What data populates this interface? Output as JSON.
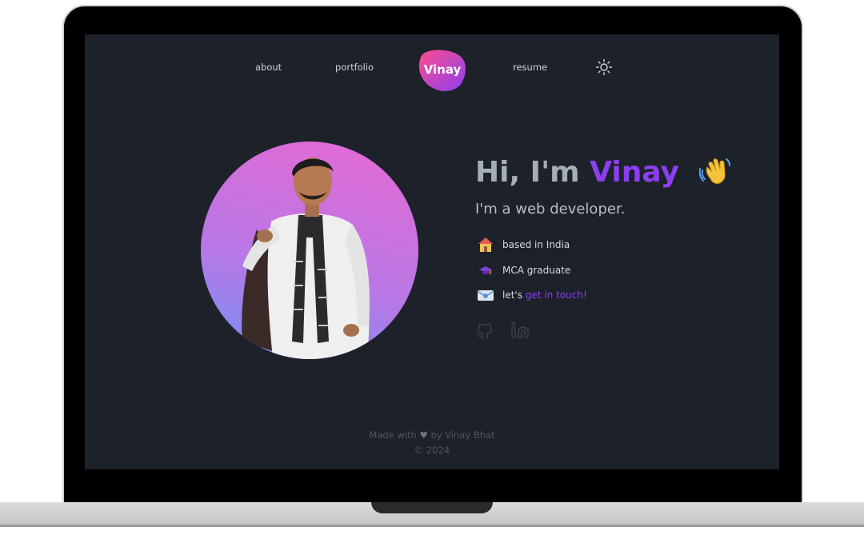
{
  "nav": {
    "about": "about",
    "portfolio": "portfolio",
    "logo_text": "Vinay",
    "resume": "resume",
    "theme_icon": "sun-icon"
  },
  "hero": {
    "greeting": "Hi, I'm",
    "name": "Vinay",
    "wave_icon": "waving-hand-icon",
    "subtitle": "I'm a web developer."
  },
  "info": {
    "location": {
      "icon": "house-icon",
      "text": "based in India"
    },
    "education": {
      "icon": "graduation-cap-icon",
      "text": "MCA graduate"
    },
    "contact": {
      "icon": "envelope-icon",
      "prefix": "let's",
      "link": "get in touch!"
    }
  },
  "social": [
    {
      "icon": "github-icon"
    },
    {
      "icon": "linkedin-icon"
    }
  ],
  "footer": {
    "made_with": "Made with",
    "heart": "♥",
    "by": "by Vinay Bhat",
    "copyright": "© 2024"
  },
  "colors": {
    "background": "#1d2129",
    "accent": "#8b3ff0",
    "logo_gradient_start": "#ff4d8d",
    "logo_gradient_end": "#8b3ff0",
    "avatar_gradient_top": "#e06bd6",
    "avatar_gradient_bottom": "#7f8cf0"
  }
}
